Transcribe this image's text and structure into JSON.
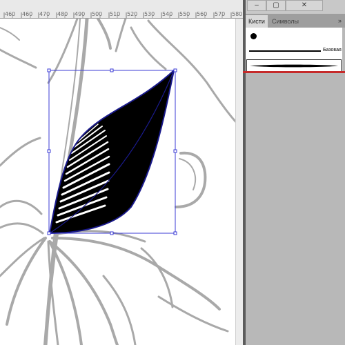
{
  "ruler": {
    "labels": [
      "460",
      "460",
      "470",
      "480",
      "490",
      "500",
      "510",
      "520",
      "530",
      "540",
      "550",
      "560",
      "570",
      "580"
    ]
  },
  "window": {
    "minimize": "‒",
    "restore": "▢",
    "close": "✕"
  },
  "panel": {
    "tabs": [
      {
        "label": "Кисти"
      },
      {
        "label": "Символы"
      }
    ],
    "more_label": "»",
    "brushes": [
      {
        "label": ""
      },
      {
        "label": "Базовая"
      },
      {
        "label": ""
      }
    ]
  },
  "colors": {
    "selection": "#3b3bd6",
    "sketch": "#a8a8a8",
    "accent": "#c62a2a",
    "leaf_fill": "#000000",
    "leaf_outline": "#1a1a8c"
  },
  "icons": [
    "brush-dot-icon",
    "window-minimize-icon",
    "window-restore-icon",
    "window-close-icon"
  ]
}
